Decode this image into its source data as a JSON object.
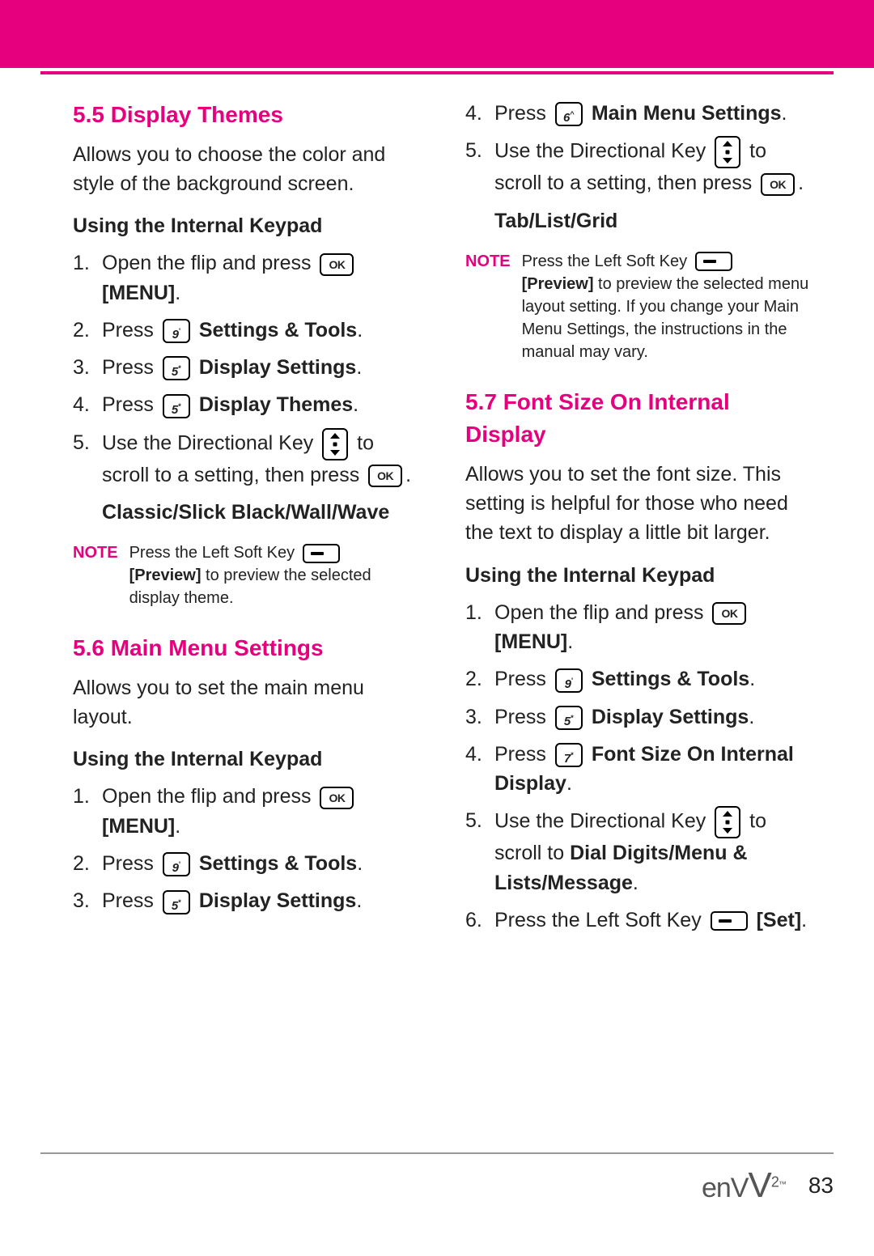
{
  "page_number": "83",
  "logo_text": "enV",
  "sec55": {
    "heading": "5.5 Display Themes",
    "intro": "Allows you to choose the color and style of the background screen.",
    "subhead": "Using the Internal Keypad",
    "s1a": "Open the flip and press ",
    "s1b": "[MENU]",
    "s2a": "Press ",
    "s2b": "Settings & Tools",
    "s3a": "Press ",
    "s3b": "Display Settings",
    "s4a": "Press ",
    "s4b": "Display Themes",
    "s5a": "Use the Directional Key ",
    "s5b": " to scroll to a setting, then press ",
    "options": "Classic/Slick Black/Wall/Wave",
    "note_label": "NOTE",
    "note_a": "Press the Left Soft Key ",
    "note_b": "[Preview]",
    "note_c": " to preview the selected display theme.",
    "key2": "9",
    "key2s": "'",
    "key3": "5",
    "key3s": "*",
    "key4": "5",
    "key4s": "*",
    "ok": "OK"
  },
  "sec56": {
    "heading": "5.6 Main Menu Settings",
    "intro": "Allows you to set the main menu layout.",
    "subhead": "Using the Internal Keypad",
    "s1a": "Open the flip and press ",
    "s1b": "[MENU]",
    "s2a": "Press ",
    "s2b": "Settings & Tools",
    "s3a": "Press ",
    "s3b": "Display Settings",
    "s4a": "Press ",
    "s4b": "Main Menu Settings",
    "s5a": "Use the Directional Key ",
    "s5b": " to scroll to a setting, then press ",
    "options": "Tab/List/Grid",
    "note_label": "NOTE",
    "note_a": "Press the Left Soft Key ",
    "note_b": "[Preview]",
    "note_c": " to preview the selected menu layout setting. If you change your Main Menu Settings, the instructions in the manual may vary.",
    "key2": "9",
    "key2s": "'",
    "key3": "5",
    "key3s": "*",
    "key4": "6",
    "key4s": "^",
    "ok": "OK"
  },
  "sec57": {
    "heading": "5.7 Font Size On Internal Display",
    "intro": "Allows you to set the font size. This setting is helpful for those who need the text to display a little bit larger.",
    "subhead": "Using the Internal Keypad",
    "s1a": "Open the flip and press ",
    "s1b": "[MENU]",
    "s2a": "Press ",
    "s2b": "Settings & Tools",
    "s3a": "Press ",
    "s3b": "Display Settings",
    "s4a": "Press ",
    "s4b": "Font Size On Internal Display",
    "s5a": "Use the Directional Key ",
    "s5b": " to scroll to ",
    "s5c": "Dial Digits/Menu & Lists/Message",
    "s6a": "Press the Left Soft Key ",
    "s6b": "[Set]",
    "key2": "9",
    "key2s": "'",
    "key3": "5",
    "key3s": "*",
    "key4": "7",
    "key4s": "*",
    "ok": "OK"
  }
}
